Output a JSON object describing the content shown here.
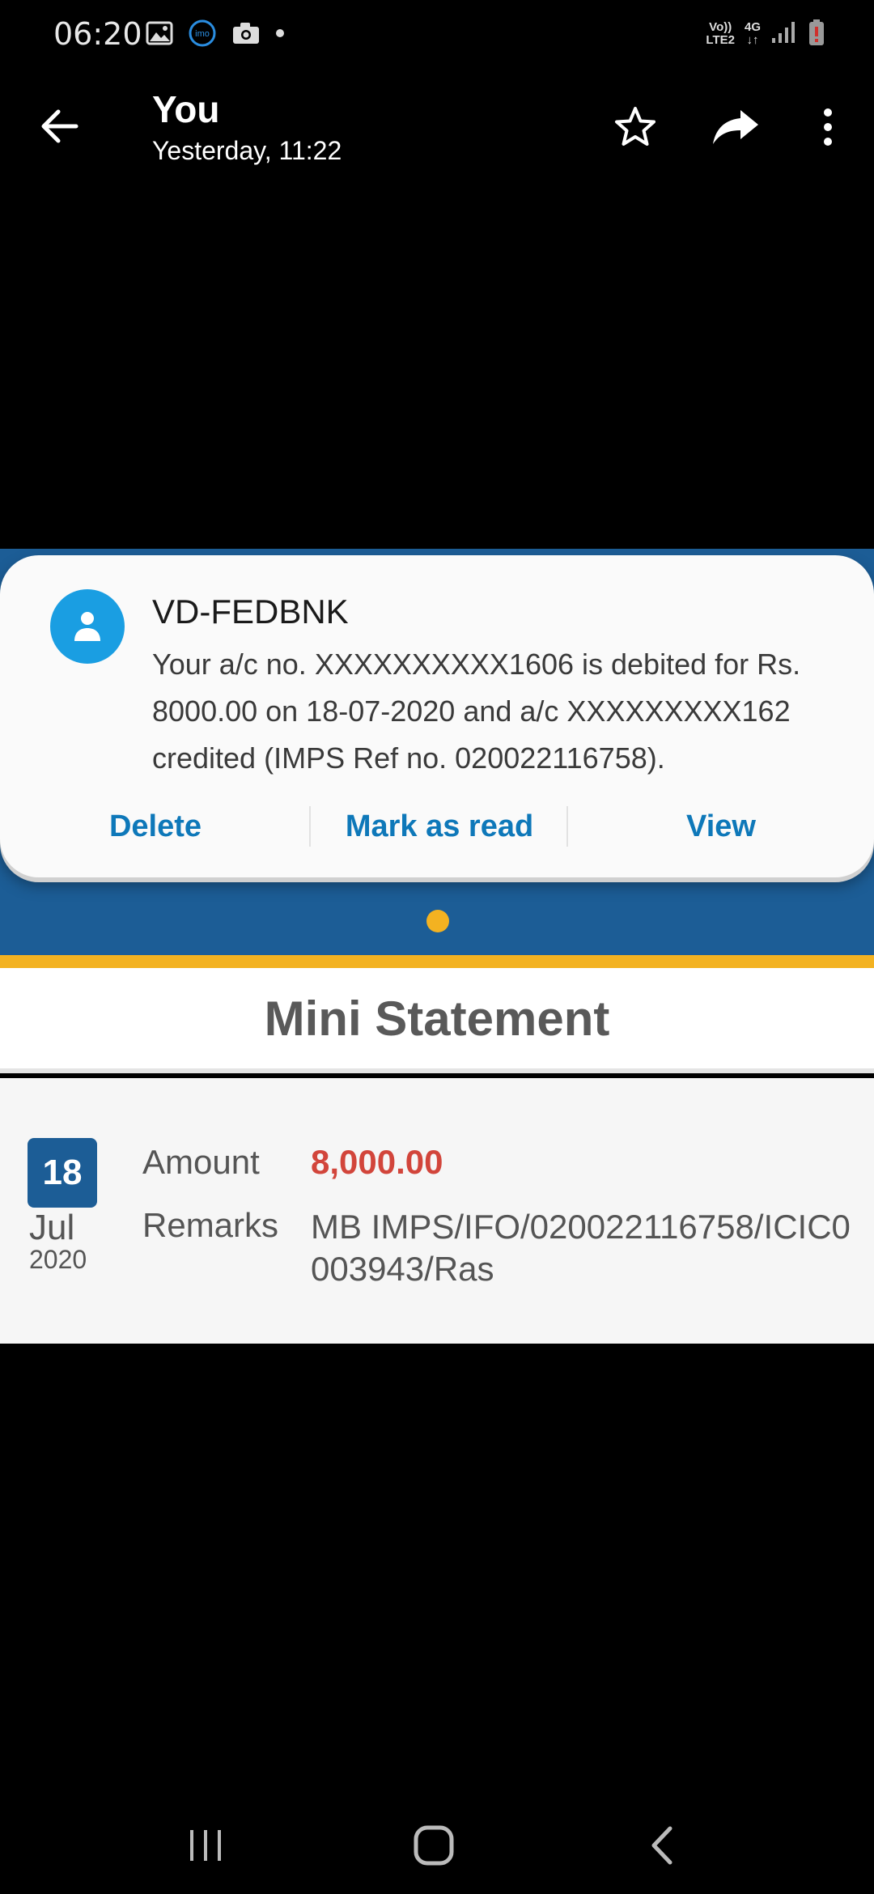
{
  "status_bar": {
    "time": "06:20",
    "left_icons": [
      "image-icon",
      "imo-icon",
      "camera-icon",
      "dot-icon"
    ],
    "imo_label": "imo",
    "volte_label_top": "Vo))",
    "volte_label_bottom": "LTE2",
    "network_label": "4G",
    "signal_icon": "signal-bars-icon",
    "battery_icon": "battery-low-icon"
  },
  "header": {
    "title": "You",
    "subtitle": "Yesterday, 11:22",
    "icons": [
      "back-arrow-icon",
      "star-icon",
      "share-icon",
      "more-vert-icon"
    ]
  },
  "notification": {
    "sender": "VD-FEDBNK",
    "body": "Your a/c no. XXXXXXXXXX1606 is debited for Rs. 8000.00 on 18-07-2020 and a/c XXXXXXXXX162 credited (IMPS Ref no. 020022116758).",
    "actions": {
      "delete": "Delete",
      "mark_read": "Mark as read",
      "view": "View"
    },
    "avatar_icon": "person-icon"
  },
  "statement": {
    "title": "Mini Statement",
    "day": "18",
    "month": "Jul",
    "year": "2020",
    "amount_label": "Amount",
    "amount_value": "8,000.00",
    "remarks_label": "Remarks",
    "remarks_value": "MB IMPS/IFO/020022116758/ICIC0003943/Ras"
  },
  "colors": {
    "bank_blue": "#1c5d96",
    "bank_yellow": "#f3b221",
    "action_blue": "#0e78b9",
    "amount_red": "#d2453b",
    "avatar_blue": "#1a9ee2"
  },
  "nav_icons": [
    "recents-icon",
    "home-icon",
    "back-icon"
  ]
}
